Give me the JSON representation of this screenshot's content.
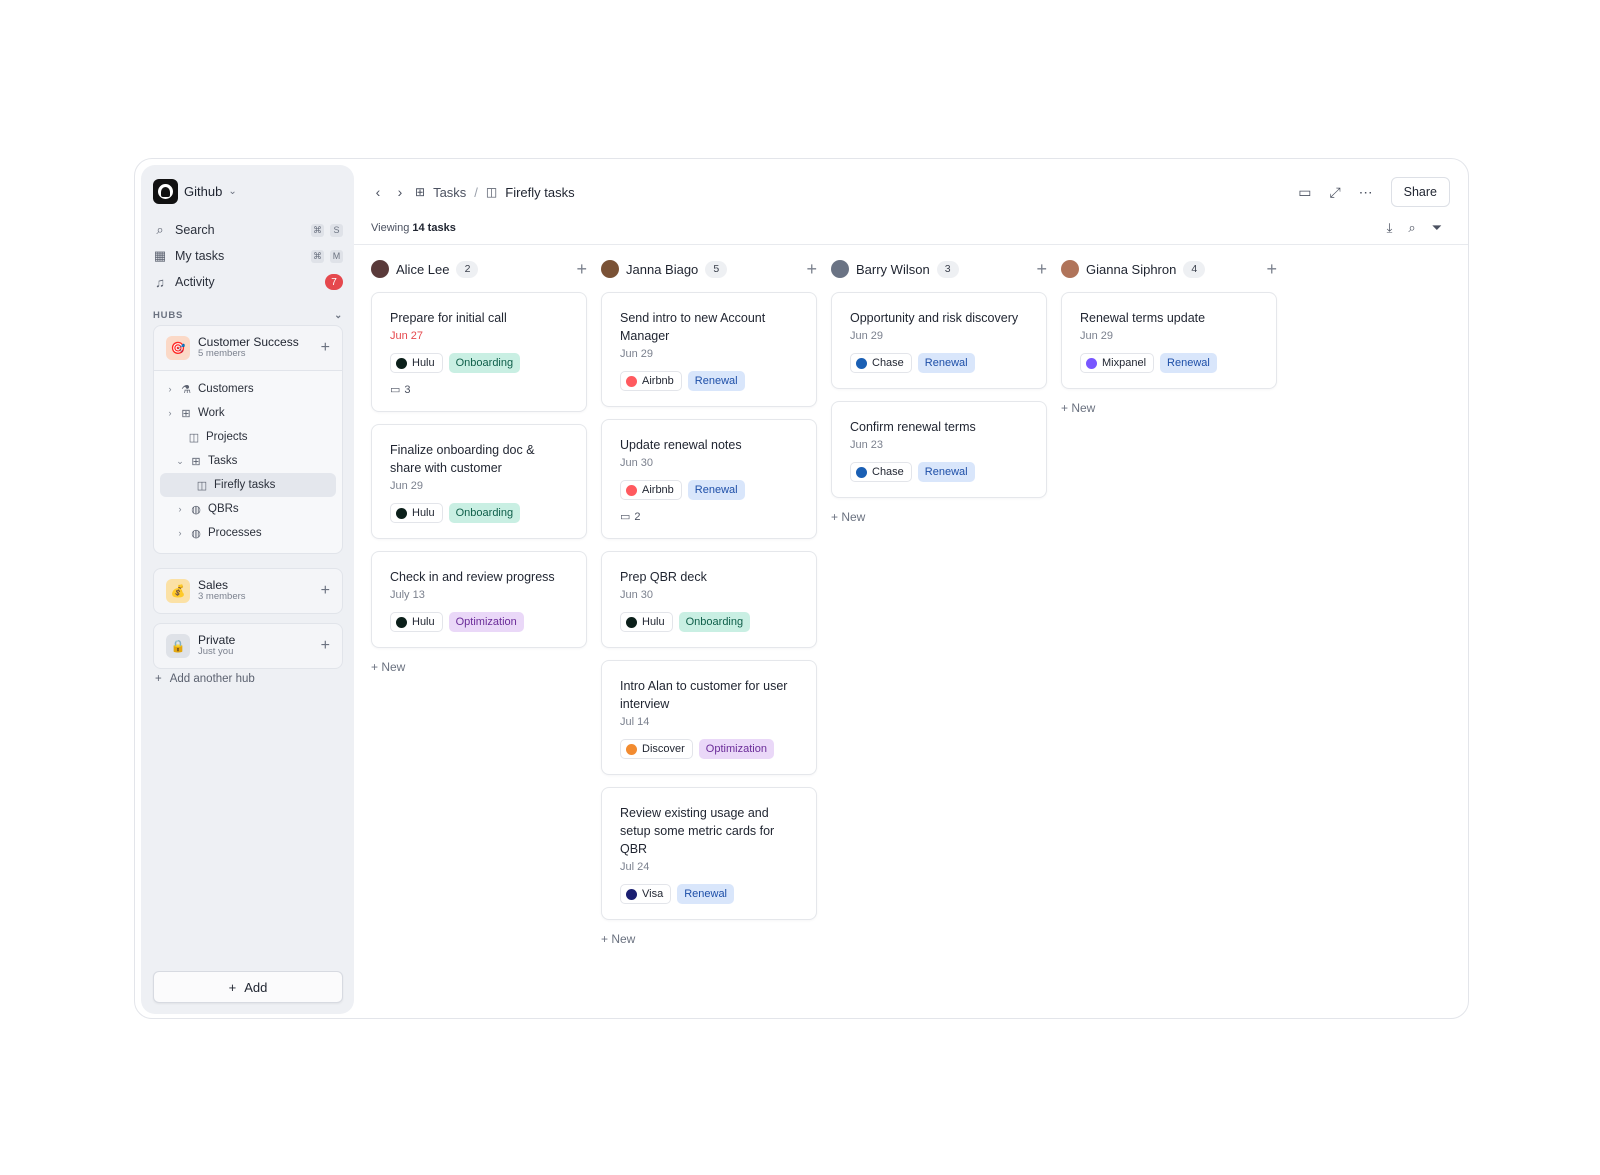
{
  "sidebar": {
    "workspace": "Github",
    "nav": [
      {
        "label": "Search",
        "keys": [
          "⌘",
          "S"
        ]
      },
      {
        "label": "My tasks",
        "keys": [
          "⌘",
          "M"
        ]
      },
      {
        "label": "Activity",
        "badge": "7"
      }
    ],
    "hubs_title": "HUBS",
    "hubs": [
      {
        "name": "Customer Success",
        "sub": "5 members"
      },
      {
        "name": "Sales",
        "sub": "3 members"
      },
      {
        "name": "Private",
        "sub": "Just you"
      }
    ],
    "tree": [
      {
        "label": "Customers"
      },
      {
        "label": "Work"
      },
      {
        "label": "Projects"
      },
      {
        "label": "Tasks"
      },
      {
        "label": "Firefly tasks"
      },
      {
        "label": "QBRs"
      },
      {
        "label": "Processes"
      }
    ],
    "add_hub": "Add another hub",
    "add_button": "Add"
  },
  "breadcrumb": {
    "parent": "Tasks",
    "separator": "/",
    "current": "Firefly tasks"
  },
  "share_label": "Share",
  "viewing": {
    "prefix": "Viewing",
    "count": "14 tasks"
  },
  "new_label": "+ New",
  "columns": [
    {
      "name": "Alice Lee",
      "count": "2",
      "avatar_color": "#5a3a3a",
      "cards": [
        {
          "title": "Prepare for initial call",
          "date": "Jun 27",
          "overdue": true,
          "company": "Hulu",
          "tag": "Onboarding",
          "comments": "3"
        },
        {
          "title": "Finalize onboarding doc & share with customer",
          "date": "Jun 29",
          "company": "Hulu",
          "tag": "Onboarding"
        },
        {
          "title": "Check in and review progress",
          "date": "July 13",
          "company": "Hulu",
          "tag": "Optimization"
        }
      ]
    },
    {
      "name": "Janna Biago",
      "count": "5",
      "avatar_color": "#7a5236",
      "cards": [
        {
          "title": "Send intro to new Account Manager",
          "date": "Jun 29",
          "company": "Airbnb",
          "tag": "Renewal"
        },
        {
          "title": "Update renewal notes",
          "date": "Jun 30",
          "company": "Airbnb",
          "tag": "Renewal",
          "comments": "2"
        },
        {
          "title": "Prep QBR deck",
          "date": "Jun 30",
          "company": "Hulu",
          "tag": "Onboarding"
        },
        {
          "title": "Intro Alan to customer for user interview",
          "date": "Jul 14",
          "company": "Discover",
          "tag": "Optimization"
        },
        {
          "title": "Review existing usage and setup some metric cards for QBR",
          "date": "Jul 24",
          "company": "Visa",
          "tag": "Renewal"
        }
      ]
    },
    {
      "name": "Barry Wilson",
      "count": "3",
      "avatar_color": "#6a7384",
      "cards": [
        {
          "title": "Opportunity and risk discovery",
          "date": "Jun 29",
          "company": "Chase",
          "tag": "Renewal"
        },
        {
          "title": "Confirm renewal terms",
          "date": "Jun 23",
          "company": "Chase",
          "tag": "Renewal"
        }
      ]
    },
    {
      "name": "Gianna Siphron",
      "count": "4",
      "avatar_color": "#b0745a",
      "cards": [
        {
          "title": "Renewal terms update",
          "date": "Jun 29",
          "company": "Mixpanel",
          "tag": "Renewal"
        }
      ]
    }
  ],
  "colors": {
    "Hulu": "#0b1f1a",
    "Airbnb": "#ff5a5f",
    "Chase": "#1a5fb4",
    "Mixpanel": "#7856ff",
    "Discover": "#f28b30",
    "Visa": "#1a1f71",
    "overdue": "#e5484d"
  }
}
